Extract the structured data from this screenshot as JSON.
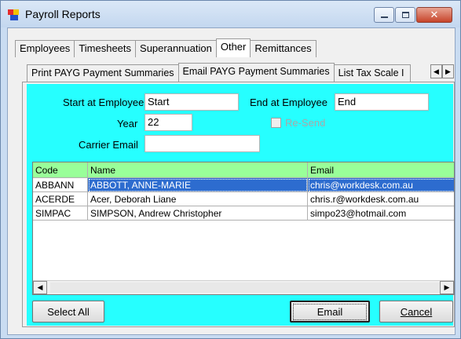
{
  "window": {
    "title": "Payroll Reports",
    "close_glyph": "✕"
  },
  "main_tabs": [
    {
      "label": "Employees",
      "active": false
    },
    {
      "label": "Timesheets",
      "active": false
    },
    {
      "label": "Superannuation",
      "active": false
    },
    {
      "label": "Other",
      "active": true
    },
    {
      "label": "Remittances",
      "active": false
    }
  ],
  "sub_tabs": [
    {
      "label": "Print PAYG Payment Summaries",
      "active": false
    },
    {
      "label": "Email PAYG Payment Summaries",
      "active": true
    },
    {
      "label": "List Tax Scale I",
      "active": false
    }
  ],
  "form": {
    "start_label": "Start at Employee",
    "start_value": "Start",
    "end_label": "End at Employee",
    "end_value": "End",
    "year_label": "Year",
    "year_value": "22",
    "resend_label": "Re-Send",
    "carrier_label": "Carrier Email",
    "carrier_value": ""
  },
  "grid": {
    "columns": [
      "Code",
      "Name",
      "Email"
    ],
    "rows": [
      {
        "code": "ABBANN",
        "name": "ABBOTT, ANNE-MARIE",
        "email": "chris@workdesk.com.au",
        "selected": true
      },
      {
        "code": "ACERDE",
        "name": "Acer, Deborah Liane",
        "email": "chris.r@workdesk.com.au",
        "selected": false
      },
      {
        "code": "SIMPAC",
        "name": "SIMPSON, Andrew Christopher",
        "email": "simpo23@hotmail.com",
        "selected": false
      }
    ]
  },
  "buttons": {
    "select_all": "Select All",
    "email": "Email",
    "cancel": "Cancel"
  },
  "colors": {
    "panel_bg": "#26ffff",
    "grid_header_bg": "#99ff99",
    "selection_bg": "#2d6ccf"
  }
}
